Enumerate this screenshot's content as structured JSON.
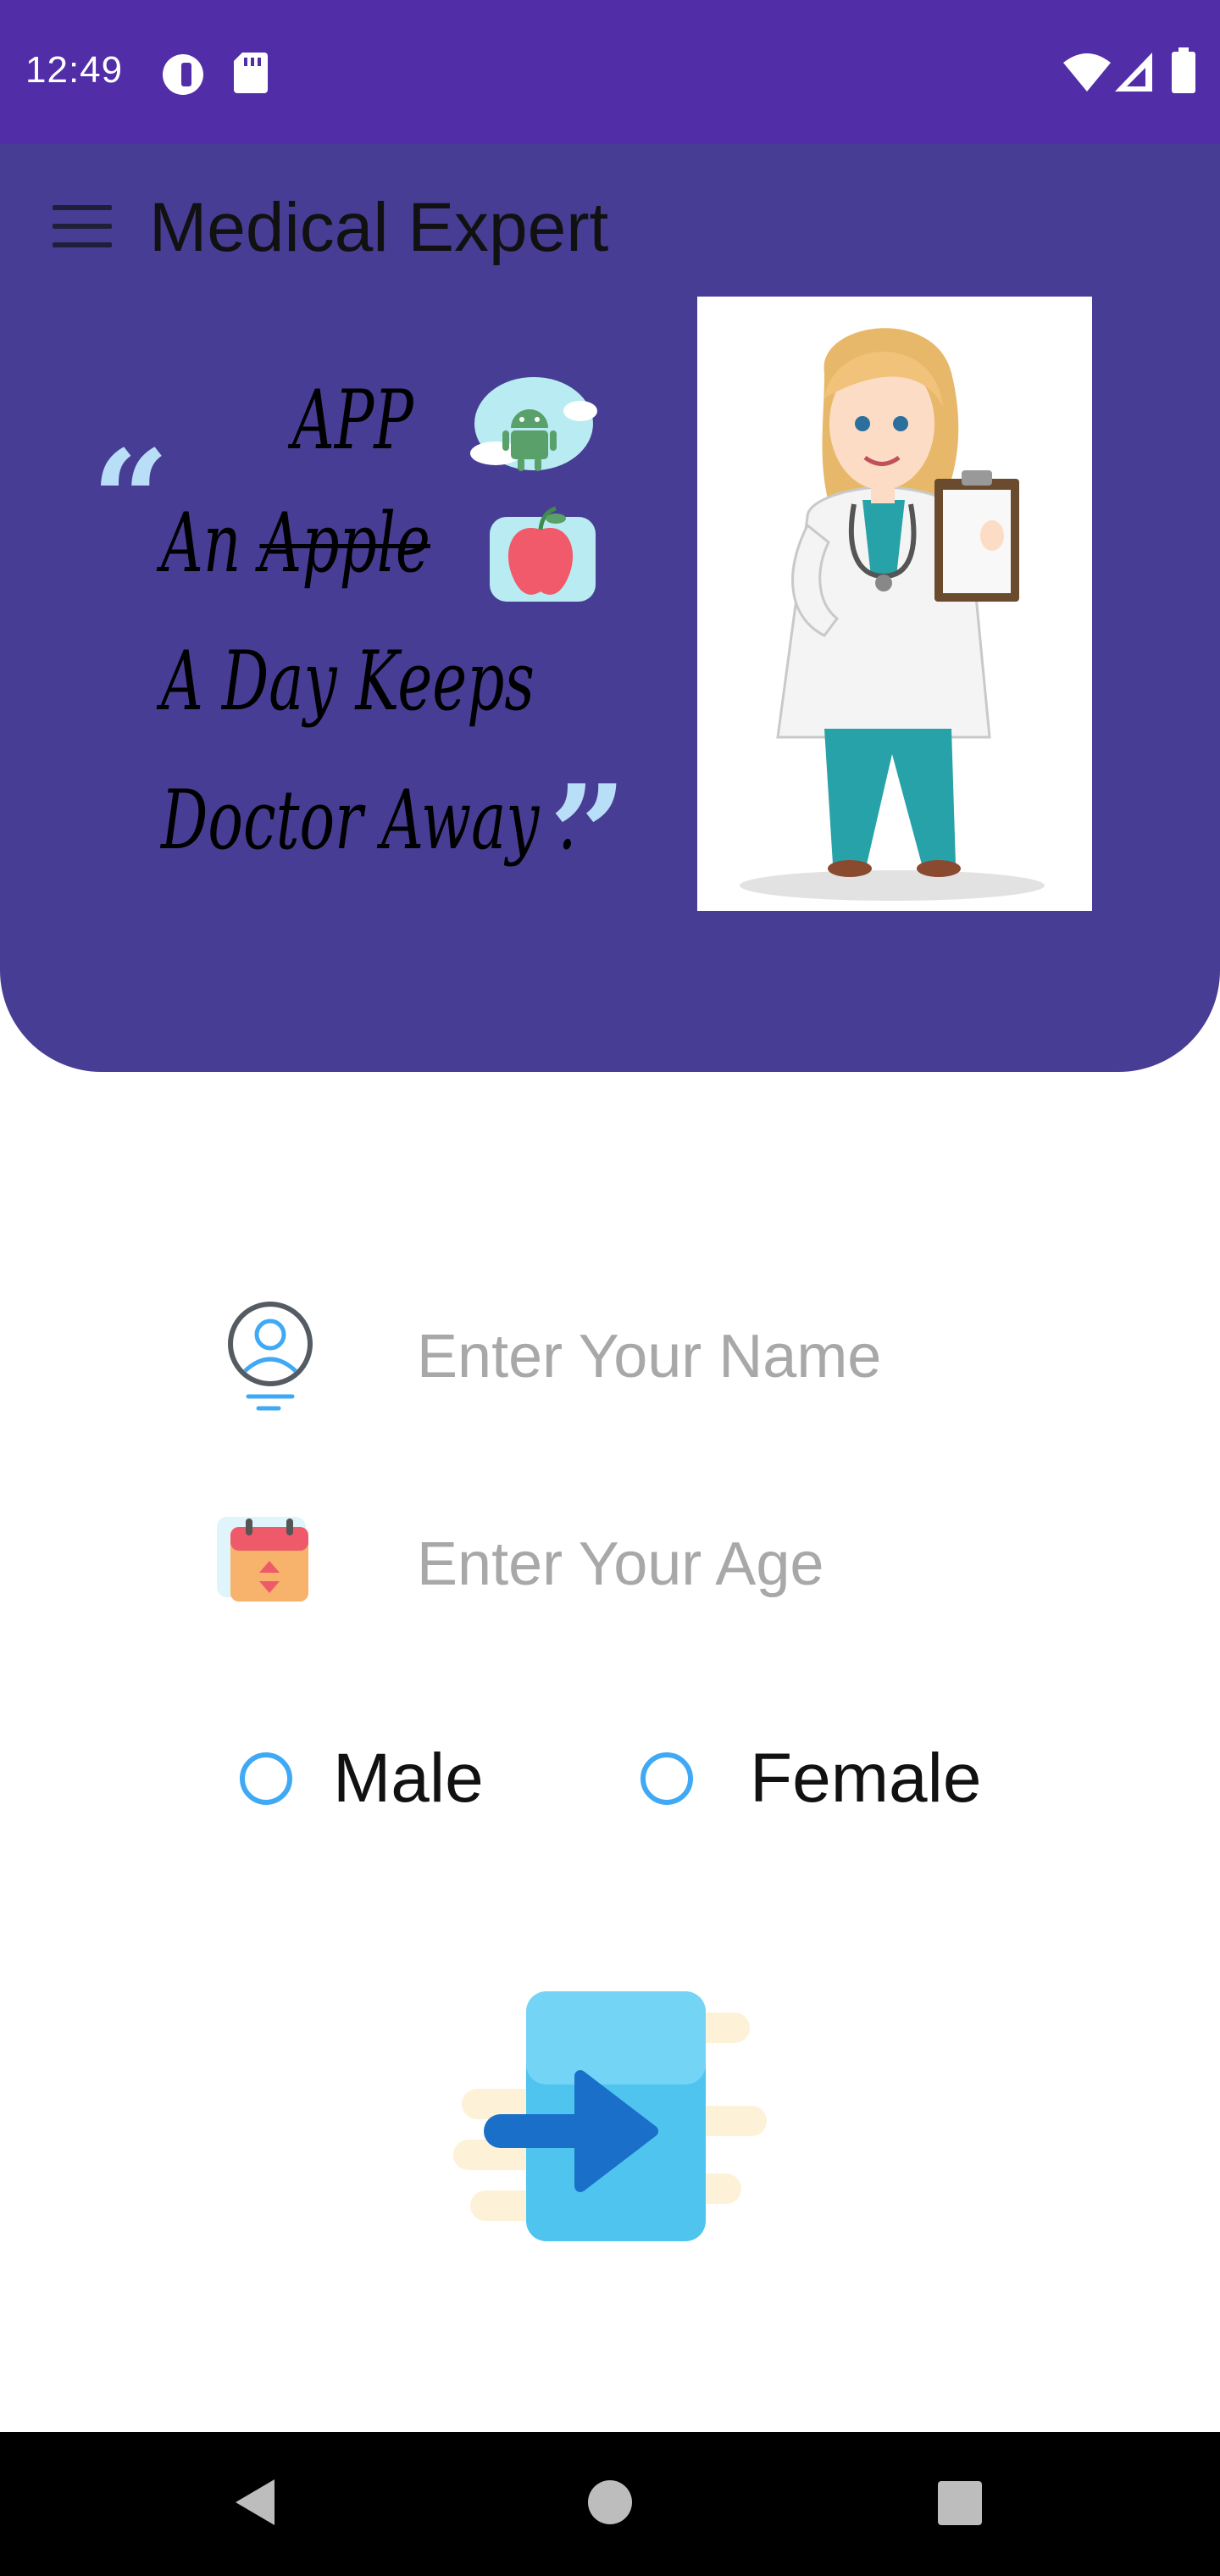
{
  "status_bar": {
    "time": "12:49",
    "icons": [
      "record-icon",
      "sd-card-icon",
      "wifi-icon",
      "signal-icon",
      "battery-icon"
    ]
  },
  "app_bar": {
    "title": "Medical Expert",
    "menu_icon": "hamburger-menu-icon"
  },
  "banner": {
    "quote_lines": [
      "APP",
      "An ",
      "Apple",
      "A Day Keeps",
      "Doctor Away ."
    ],
    "open_quote": "“",
    "close_quote": "”",
    "stickers": [
      "android-cloud-icon",
      "apple-icon"
    ],
    "image": "doctor-illustration"
  },
  "form": {
    "name_placeholder": "Enter Your Name",
    "age_placeholder": "Enter Your Age",
    "name_icon": "user-icon",
    "age_icon": "calendar-icon",
    "gender_options": [
      "Male",
      "Female"
    ],
    "submit_icon": "login-arrow-icon"
  },
  "colors": {
    "status_bar": "#512da8",
    "header": "#483d94",
    "radio": "#3fa9f5",
    "placeholder": "#a8a8a8"
  },
  "nav_bar": {
    "buttons": [
      "back-icon",
      "home-icon",
      "recents-icon"
    ]
  }
}
